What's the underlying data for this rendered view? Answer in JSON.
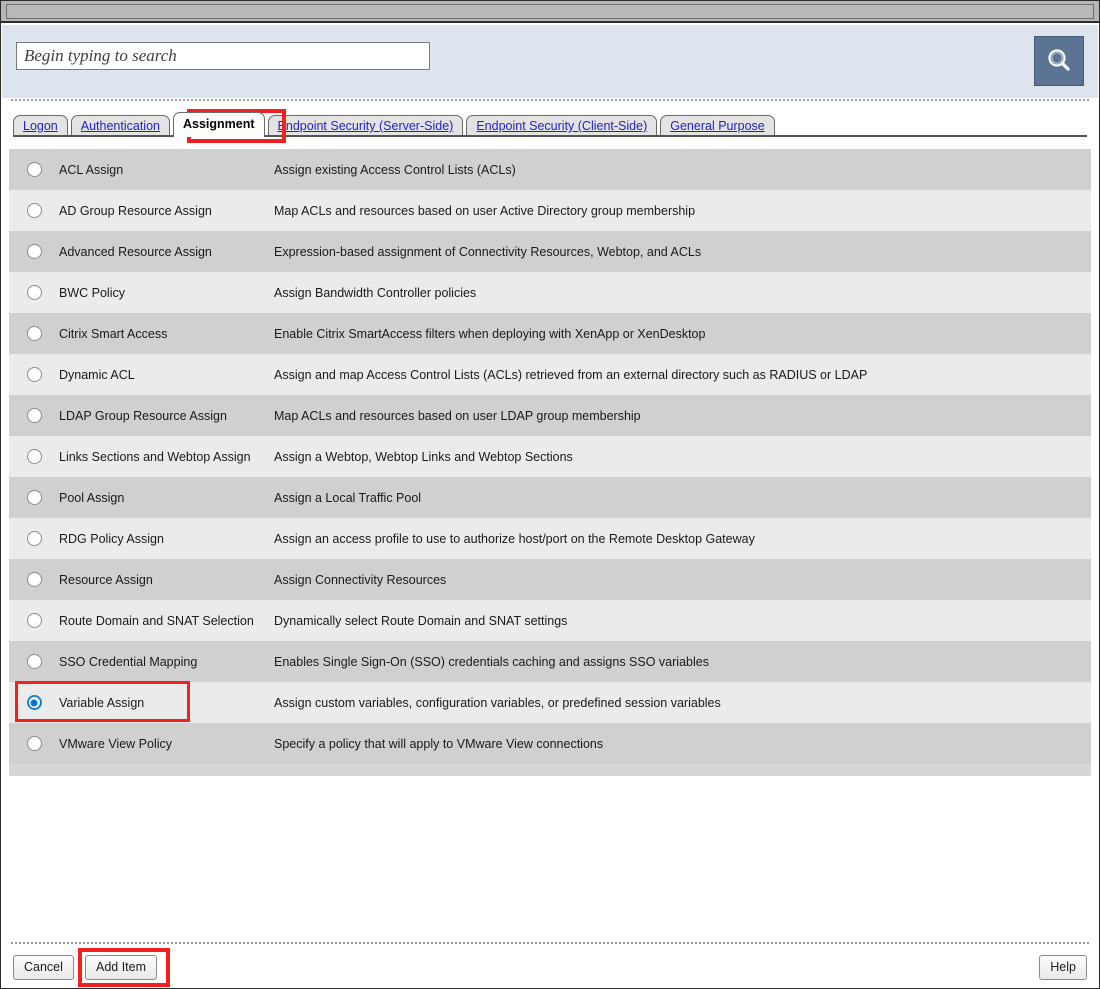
{
  "window": {
    "title": ""
  },
  "search": {
    "placeholder": "Begin typing to search",
    "value": "",
    "button_icon": "search-icon"
  },
  "tabs": [
    {
      "label": "Logon",
      "active": false
    },
    {
      "label": "Authentication",
      "active": false
    },
    {
      "label": "Assignment",
      "active": true
    },
    {
      "label": "Endpoint Security (Server-Side)",
      "active": false
    },
    {
      "label": "Endpoint Security (Client-Side)",
      "active": false
    },
    {
      "label": "General Purpose",
      "active": false
    }
  ],
  "items": [
    {
      "name": "ACL Assign",
      "description": "Assign existing Access Control Lists (ACLs)",
      "selected": false
    },
    {
      "name": "AD Group Resource Assign",
      "description": "Map ACLs and resources based on user Active Directory group membership",
      "selected": false
    },
    {
      "name": "Advanced Resource Assign",
      "description": "Expression-based assignment of Connectivity Resources, Webtop, and ACLs",
      "selected": false
    },
    {
      "name": "BWC Policy",
      "description": "Assign Bandwidth Controller policies",
      "selected": false
    },
    {
      "name": "Citrix Smart Access",
      "description": "Enable Citrix SmartAccess filters when deploying with XenApp or XenDesktop",
      "selected": false
    },
    {
      "name": "Dynamic ACL",
      "description": "Assign and map Access Control Lists (ACLs) retrieved from an external directory such as RADIUS or LDAP",
      "selected": false
    },
    {
      "name": "LDAP Group Resource Assign",
      "description": "Map ACLs and resources based on user LDAP group membership",
      "selected": false
    },
    {
      "name": "Links Sections and Webtop Assign",
      "description": "Assign a Webtop, Webtop Links and Webtop Sections",
      "selected": false
    },
    {
      "name": "Pool Assign",
      "description": "Assign a Local Traffic Pool",
      "selected": false
    },
    {
      "name": "RDG Policy Assign",
      "description": "Assign an access profile to use to authorize host/port on the Remote Desktop Gateway",
      "selected": false
    },
    {
      "name": "Resource Assign",
      "description": "Assign Connectivity Resources",
      "selected": false
    },
    {
      "name": "Route Domain and SNAT Selection",
      "description": "Dynamically select Route Domain and SNAT settings",
      "selected": false
    },
    {
      "name": "SSO Credential Mapping",
      "description": "Enables Single Sign-On (SSO) credentials caching and assigns SSO variables",
      "selected": false
    },
    {
      "name": "Variable Assign",
      "description": "Assign custom variables, configuration variables, or predefined session variables",
      "selected": true
    },
    {
      "name": "VMware View Policy",
      "description": "Specify a policy that will apply to VMware View connections",
      "selected": false
    }
  ],
  "footer": {
    "cancel_label": "Cancel",
    "add_item_label": "Add Item",
    "help_label": "Help"
  },
  "colors": {
    "highlight": "#f42020",
    "row_odd": "#d0d0d0",
    "row_even": "#ebebeb",
    "search_band": "#dde4ee",
    "search_button": "#5b7493",
    "tab_link": "#2222cc",
    "radio_selected": "#1170cf"
  }
}
